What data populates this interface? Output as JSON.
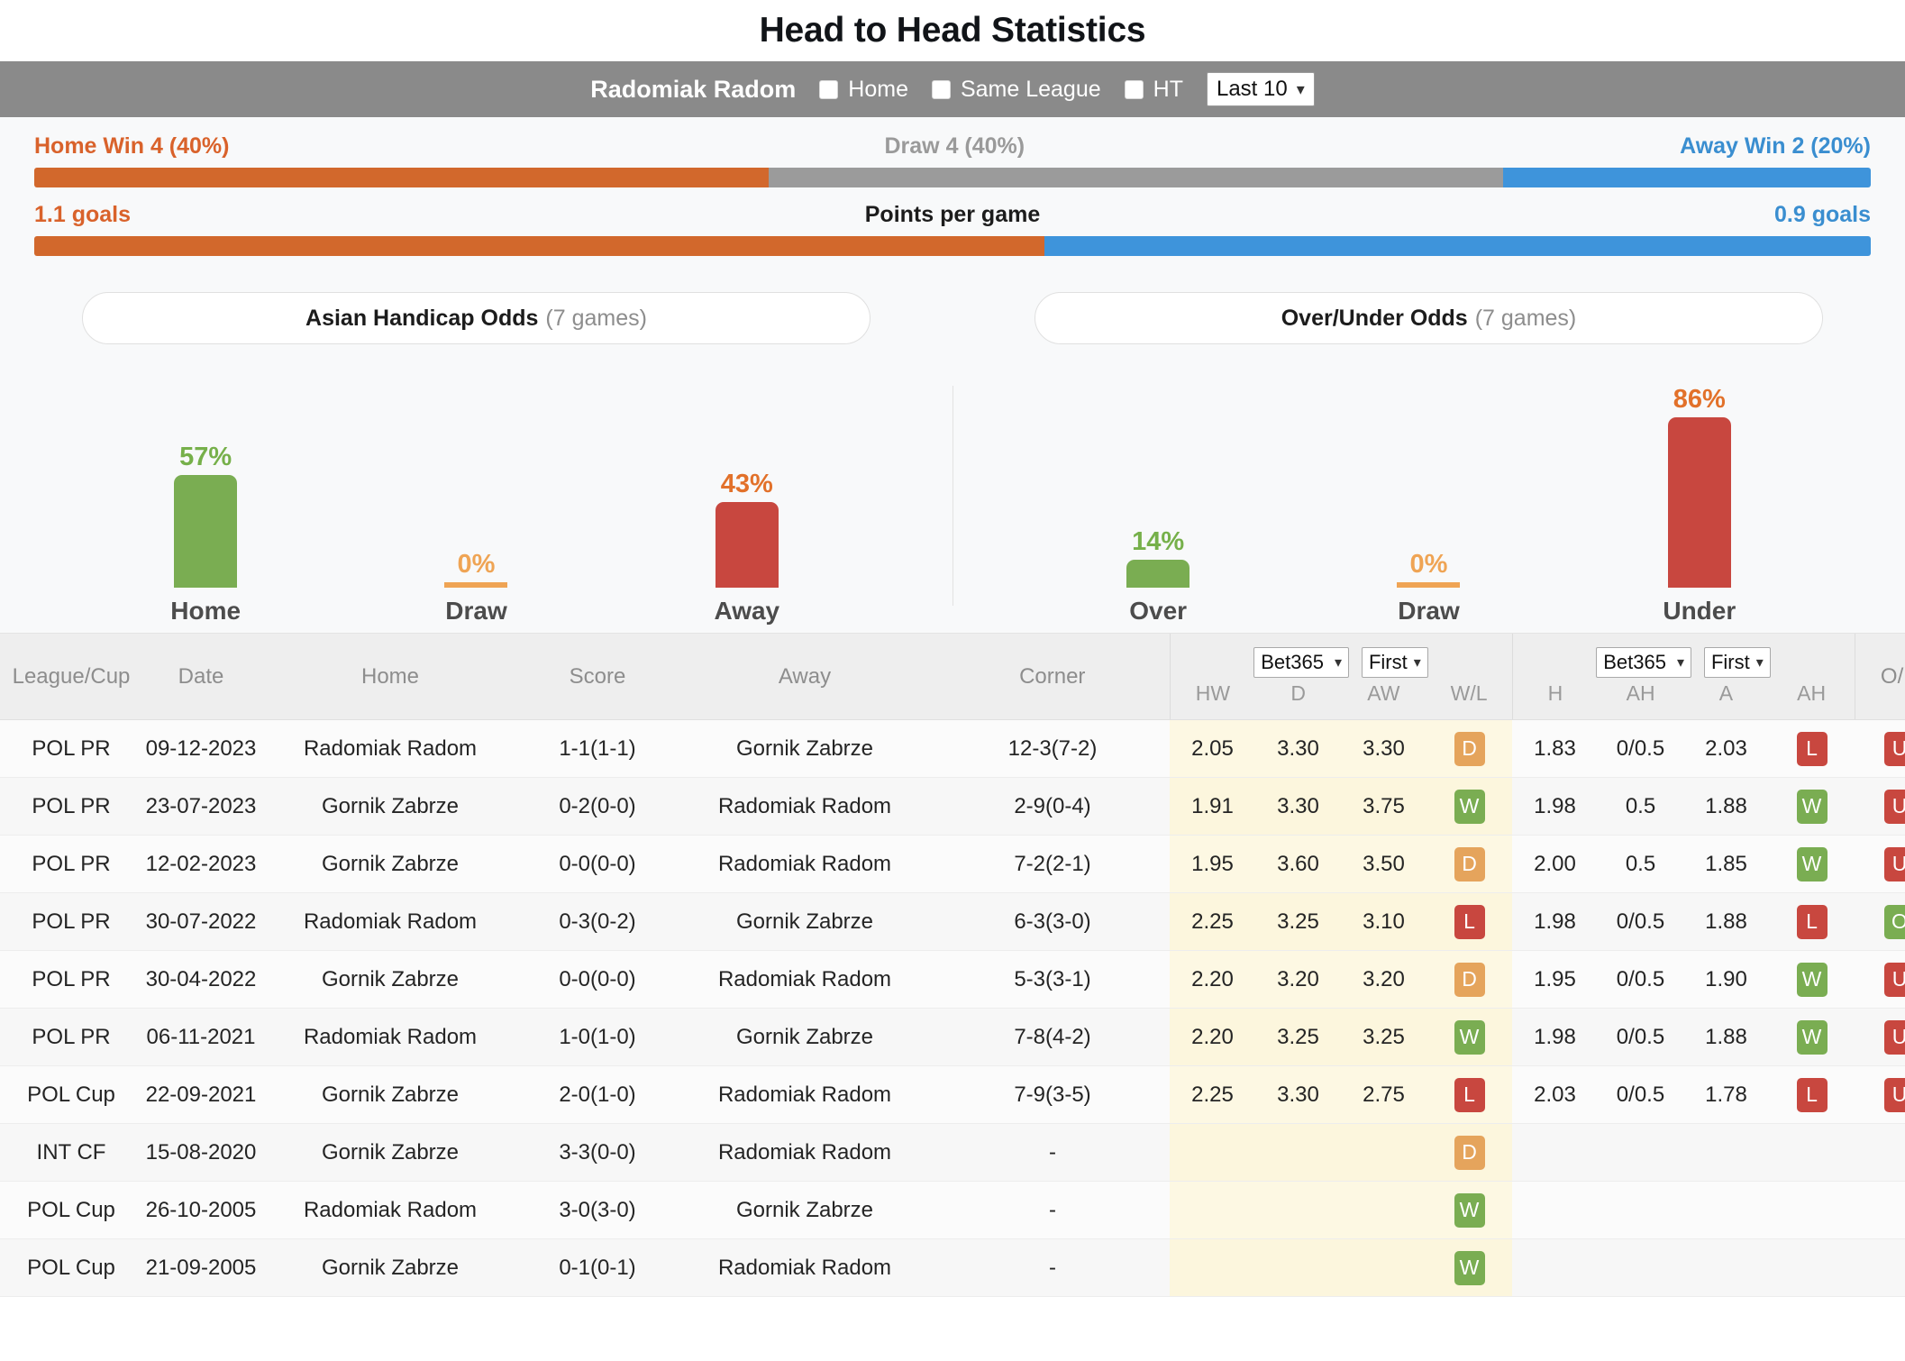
{
  "page_title": "Head to Head Statistics",
  "controls": {
    "team_name": "Radomiak Radom",
    "checkboxes": [
      {
        "label": "Home",
        "checked": false
      },
      {
        "label": "Same League",
        "checked": false
      },
      {
        "label": "HT",
        "checked": false
      }
    ],
    "range_select": {
      "value": "Last 10"
    }
  },
  "summary": {
    "result_row": {
      "home_label": "Home Win 4 (40%)",
      "draw_label": "Draw 4 (40%)",
      "away_label": "Away Win 2 (20%)",
      "home_pct": 40,
      "draw_pct": 40,
      "away_pct": 20
    },
    "ppg_row": {
      "home_label": "1.1 goals",
      "mid_label": "Points per game",
      "away_label": "0.9 goals",
      "home_pct": 55,
      "away_pct": 45
    }
  },
  "odds_panels": [
    {
      "title": "Asian Handicap Odds",
      "games": "(7 games)",
      "bars": [
        {
          "caption": "Home",
          "pct_label": "57%",
          "value": 57,
          "color": "green"
        },
        {
          "caption": "Draw",
          "pct_label": "0%",
          "value": 0,
          "color": "amber"
        },
        {
          "caption": "Away",
          "pct_label": "43%",
          "value": 43,
          "color": "red"
        }
      ]
    },
    {
      "title": "Over/Under Odds",
      "games": "(7 games)",
      "bars": [
        {
          "caption": "Over",
          "pct_label": "14%",
          "value": 14,
          "color": "green"
        },
        {
          "caption": "Draw",
          "pct_label": "0%",
          "value": 0,
          "color": "amber"
        },
        {
          "caption": "Under",
          "pct_label": "86%",
          "value": 86,
          "color": "red"
        }
      ]
    }
  ],
  "table": {
    "headers": {
      "league": "League/Cup",
      "date": "Date",
      "home": "Home",
      "score": "Score",
      "away": "Away",
      "corner": "Corner",
      "ou": "O/U"
    },
    "group1": {
      "bookmaker": "Bet365",
      "period": "First",
      "subs": [
        "HW",
        "D",
        "AW",
        "W/L"
      ]
    },
    "group2": {
      "bookmaker": "Bet365",
      "period": "First",
      "subs": [
        "H",
        "AH",
        "A",
        "AH"
      ]
    },
    "rows": [
      {
        "league": "POL PR",
        "date": "09-12-2023",
        "home": "Radomiak Radom",
        "home_hi": true,
        "score": "1-1",
        "score_ht": "(1-1)",
        "away": "Gornik Zabrze",
        "away_hi": false,
        "corner": "12-3(7-2)",
        "hw": "2.05",
        "d": "3.30",
        "aw": "3.30",
        "wl": "D",
        "h": "1.83",
        "ah1": "0/0.5",
        "a": "2.03",
        "ah2": "L",
        "ou": "U"
      },
      {
        "league": "POL PR",
        "date": "23-07-2023",
        "home": "Gornik Zabrze",
        "home_hi": false,
        "score": "0-2",
        "score_ht": "(0-0)",
        "away": "Radomiak Radom",
        "away_hi": true,
        "corner": "2-9(0-4)",
        "hw": "1.91",
        "d": "3.30",
        "aw": "3.75",
        "wl": "W",
        "h": "1.98",
        "ah1": "0.5",
        "a": "1.88",
        "ah2": "W",
        "ou": "U"
      },
      {
        "league": "POL PR",
        "date": "12-02-2023",
        "home": "Gornik Zabrze",
        "home_hi": false,
        "score": "0-0",
        "score_ht": "(0-0)",
        "away": "Radomiak Radom",
        "away_hi": true,
        "corner": "7-2(2-1)",
        "hw": "1.95",
        "d": "3.60",
        "aw": "3.50",
        "wl": "D",
        "h": "2.00",
        "ah1": "0.5",
        "a": "1.85",
        "ah2": "W",
        "ou": "U"
      },
      {
        "league": "POL PR",
        "date": "30-07-2022",
        "home": "Radomiak Radom",
        "home_hi": true,
        "score": "0-3",
        "score_ht": "(0-2)",
        "away": "Gornik Zabrze",
        "away_hi": false,
        "corner": "6-3(3-0)",
        "hw": "2.25",
        "d": "3.25",
        "aw": "3.10",
        "wl": "L",
        "h": "1.98",
        "ah1": "0/0.5",
        "a": "1.88",
        "ah2": "L",
        "ou": "O"
      },
      {
        "league": "POL PR",
        "date": "30-04-2022",
        "home": "Gornik Zabrze",
        "home_hi": false,
        "score": "0-0",
        "score_ht": "(0-0)",
        "away": "Radomiak Radom",
        "away_hi": true,
        "corner": "5-3(3-1)",
        "hw": "2.20",
        "d": "3.20",
        "aw": "3.20",
        "wl": "D",
        "h": "1.95",
        "ah1": "0/0.5",
        "a": "1.90",
        "ah2": "W",
        "ou": "U"
      },
      {
        "league": "POL PR",
        "date": "06-11-2021",
        "home": "Radomiak Radom",
        "home_hi": true,
        "score": "1-0",
        "score_ht": "(1-0)",
        "away": "Gornik Zabrze",
        "away_hi": false,
        "corner": "7-8(4-2)",
        "hw": "2.20",
        "d": "3.25",
        "aw": "3.25",
        "wl": "W",
        "h": "1.98",
        "ah1": "0/0.5",
        "a": "1.88",
        "ah2": "W",
        "ou": "U"
      },
      {
        "league": "POL Cup",
        "date": "22-09-2021",
        "home": "Gornik Zabrze",
        "home_hi": false,
        "score": "2-0",
        "score_ht": "(1-0)",
        "away": "Radomiak Radom",
        "away_hi": true,
        "corner": "7-9(3-5)",
        "hw": "2.25",
        "d": "3.30",
        "aw": "2.75",
        "wl": "L",
        "h": "2.03",
        "ah1": "0/0.5",
        "a": "1.78",
        "ah2": "L",
        "ou": "U"
      },
      {
        "league": "INT CF",
        "date": "15-08-2020",
        "home": "Gornik Zabrze",
        "home_hi": false,
        "score": "3-3",
        "score_ht": "(0-0)",
        "away": "Radomiak Radom",
        "away_hi": true,
        "corner": "-",
        "hw": "",
        "d": "",
        "aw": "",
        "wl": "D",
        "h": "",
        "ah1": "",
        "a": "",
        "ah2": "",
        "ou": ""
      },
      {
        "league": "POL Cup",
        "date": "26-10-2005",
        "home": "Radomiak Radom",
        "home_hi": true,
        "score": "3-0",
        "score_ht": "(3-0)",
        "away": "Gornik Zabrze",
        "away_hi": false,
        "corner": "-",
        "hw": "",
        "d": "",
        "aw": "",
        "wl": "W",
        "h": "",
        "ah1": "",
        "a": "",
        "ah2": "",
        "ou": ""
      },
      {
        "league": "POL Cup",
        "date": "21-09-2005",
        "home": "Gornik Zabrze",
        "home_hi": false,
        "score": "0-1",
        "score_ht": "(0-1)",
        "away": "Radomiak Radom",
        "away_hi": true,
        "corner": "-",
        "hw": "",
        "d": "",
        "aw": "",
        "wl": "W",
        "h": "",
        "ah1": "",
        "a": "",
        "ah2": "",
        "ou": ""
      }
    ]
  },
  "colors": {
    "home_orange": "#d2682c",
    "draw_grey": "#9b9b9b",
    "away_blue": "#3e94db",
    "green": "#7aad52",
    "red": "#c8473f",
    "amber": "#e5a45c",
    "highlight_yellow": "#fdf8e3"
  }
}
